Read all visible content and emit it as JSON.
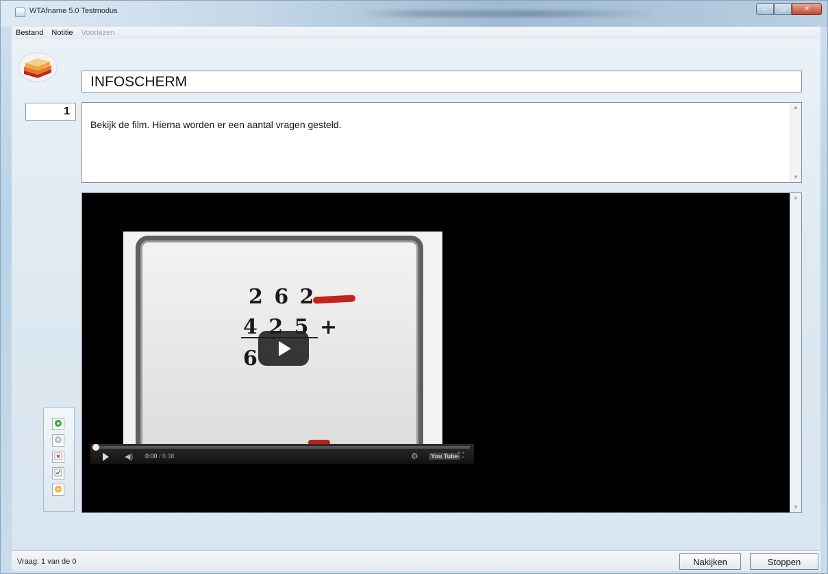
{
  "window": {
    "title": "WTAfname 5.0 Testmodus",
    "controls": {
      "minimize": "–",
      "maximize": "□",
      "close": "✕"
    }
  },
  "menu": [
    {
      "label": "Bestand",
      "enabled": true
    },
    {
      "label": "Notitie",
      "enabled": true
    },
    {
      "label": "Voorlezen",
      "enabled": false
    }
  ],
  "header": {
    "title": "INFOSCHERM"
  },
  "question": {
    "number": "1",
    "instruction": "Bekijk de film. Hierna worden er een aantal vragen gesteld."
  },
  "video": {
    "whiteboard_rows": [
      "2 6 2",
      "4 2 5 +",
      "6"
    ],
    "time_current": "0:00",
    "time_total": "/ 6:38",
    "logo": "You Tube"
  },
  "toolbar": {
    "icons": [
      "next-icon",
      "previous-icon",
      "close-icon",
      "check-icon",
      "hint-icon"
    ]
  },
  "status": {
    "text": "Vraag: 1 van de 0",
    "check_label": "Nakijken",
    "stop_label": "Stoppen"
  },
  "colors": {
    "window_bg": "#c9dce9",
    "accent_red": "#c4231c",
    "media_bg": "#000000"
  }
}
